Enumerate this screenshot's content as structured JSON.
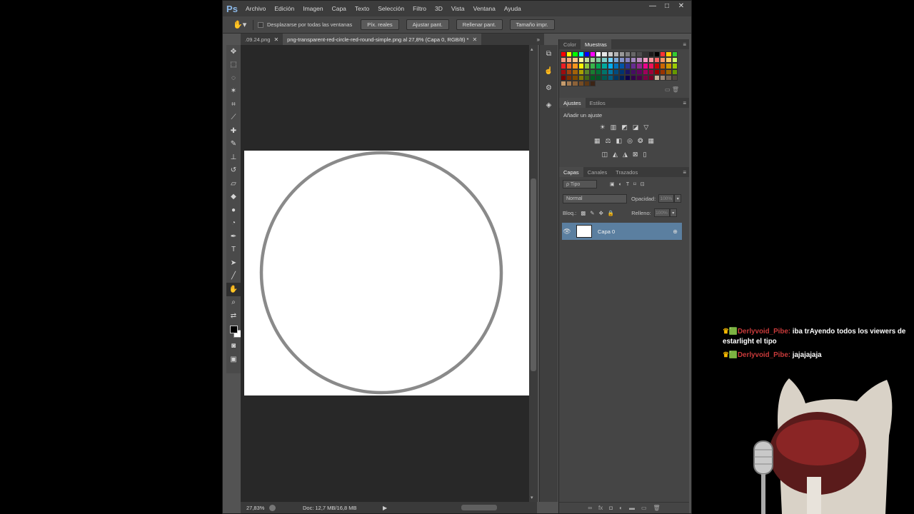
{
  "window": {
    "app_icon": "Ps",
    "menu": [
      "Archivo",
      "Edición",
      "Imagen",
      "Capa",
      "Texto",
      "Selección",
      "Filtro",
      "3D",
      "Vista",
      "Ventana",
      "Ayuda"
    ],
    "controls": {
      "minimize": "—",
      "maximize": "□",
      "close": "✕"
    }
  },
  "options": {
    "scroll_all_label": "Desplazarse por todas las ventanas",
    "btn_actual": "Píx. reales",
    "btn_fit": "Ajustar pant.",
    "btn_fill": "Rellenar pant.",
    "btn_print": "Tamaño impr."
  },
  "tabs": [
    {
      "label": ".09.24.png",
      "close": "✕"
    },
    {
      "label": "png-transparent-red-circle-red-round-simple.png al 27,8% (Capa 0, RGB/8) *",
      "close": "✕"
    }
  ],
  "status": {
    "zoom": "27,83%",
    "doc": "Doc: 12,7 MB/16,8 MB"
  },
  "panels": {
    "color_tab": "Color",
    "swatches_tab": "Muestras",
    "ajustes_tab": "Ajustes",
    "estilos_tab": "Estilos",
    "ajustes_title": "Añadir un ajuste",
    "capas_tab": "Capas",
    "canales_tab": "Canales",
    "trazados_tab": "Trazados",
    "filter_label": "ρ Tipo",
    "blend_mode": "Normal",
    "opacity_label": "Opacidad:",
    "opacity_value": "100%",
    "lock_label": "Bloq.:",
    "fill_label": "Relleno:",
    "fill_value": "100%",
    "layer_name": "Capa 0"
  },
  "swatch_colors": [
    "#ff0000",
    "#ffff00",
    "#00ff00",
    "#00ffff",
    "#0000ff",
    "#ff00ff",
    "#ffffff",
    "#e6e6e6",
    "#cccccc",
    "#b3b3b3",
    "#999999",
    "#808080",
    "#666666",
    "#4d4d4d",
    "#333333",
    "#1a1a1a",
    "#000000",
    "#ff3333",
    "#ffcc00",
    "#33cc33",
    "#f7977a",
    "#f9ad81",
    "#fdc68a",
    "#fff79a",
    "#c4df9b",
    "#a3d39c",
    "#82ca9d",
    "#7bcdc8",
    "#6ecff6",
    "#7ea7d8",
    "#8493ca",
    "#8882be",
    "#a187be",
    "#bc8dbf",
    "#f49ac2",
    "#f6989d",
    "#ff6666",
    "#ff9966",
    "#ffcc66",
    "#ccff66",
    "#ed1c24",
    "#f26522",
    "#f7941d",
    "#fff200",
    "#8dc73f",
    "#39b54a",
    "#00a651",
    "#00a99d",
    "#00aeef",
    "#0072bc",
    "#0054a6",
    "#2e3192",
    "#662d91",
    "#92278f",
    "#ec008c",
    "#ed145b",
    "#cc0000",
    "#cc6600",
    "#cc9900",
    "#99cc00",
    "#9e0b0f",
    "#a0410d",
    "#a36209",
    "#aba000",
    "#598527",
    "#1a7b30",
    "#007236",
    "#00746b",
    "#0076a3",
    "#004b80",
    "#003471",
    "#1b1464",
    "#440e62",
    "#630460",
    "#9e005d",
    "#9e0039",
    "#990000",
    "#993300",
    "#996600",
    "#669900",
    "#790000",
    "#7b2e00",
    "#7d4900",
    "#827b00",
    "#406618",
    "#005e20",
    "#005826",
    "#005952",
    "#005b7f",
    "#003663",
    "#002157",
    "#0d004c",
    "#32004b",
    "#4b0049",
    "#7b0046",
    "#7a0026",
    "#c7b299",
    "#998675",
    "#736357",
    "#534741",
    "#c69c6d",
    "#a67c52",
    "#8c6239",
    "#754c24",
    "#603913",
    "#3c2415"
  ],
  "chat": [
    {
      "badges": "♛🟩",
      "user": "Derlyvoid_Pibe:",
      "text": "iba trAyendo todos los viewers de estarlight el tipo"
    },
    {
      "badges": "♛🟩",
      "user": "Derlyvoid_Pibe:",
      "text": "jajajajaja"
    }
  ]
}
